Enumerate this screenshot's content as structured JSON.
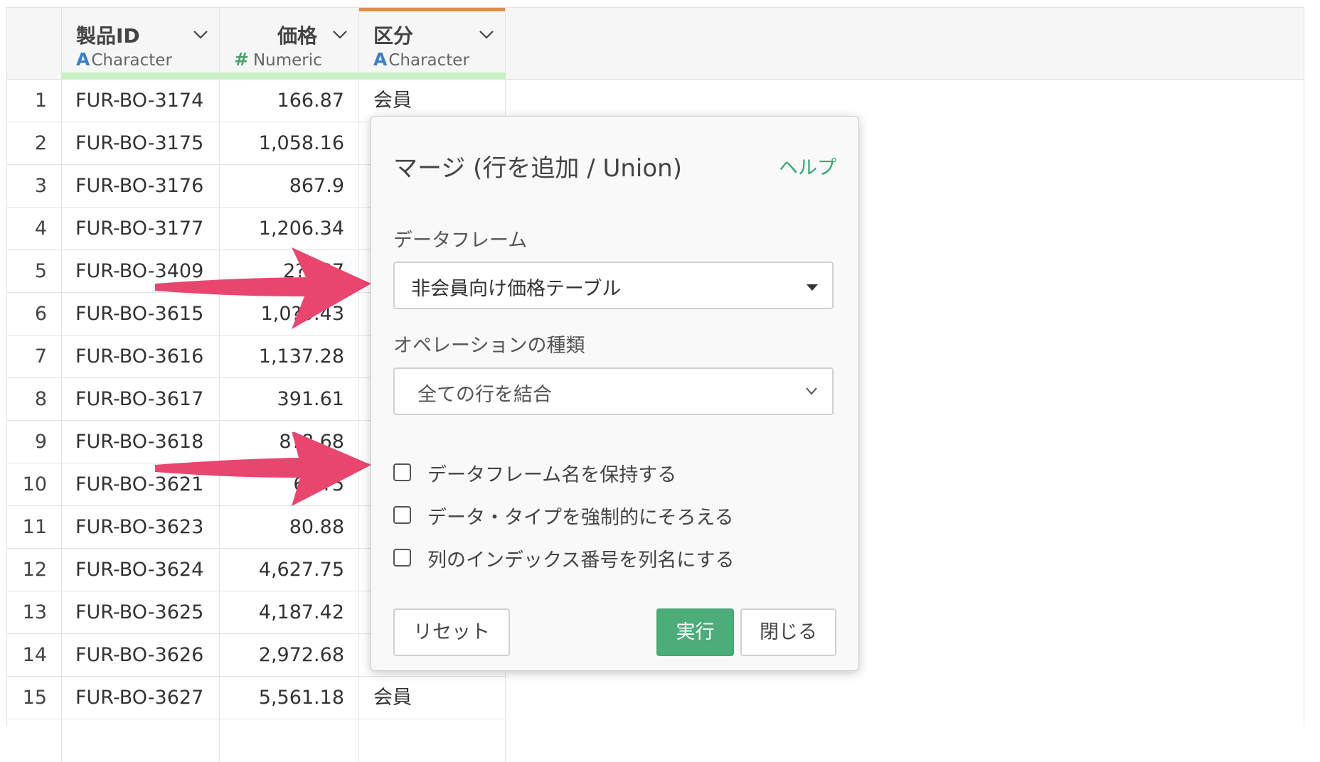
{
  "table": {
    "columns": [
      {
        "name": "製品ID",
        "type_icon": "A",
        "type_label": "Character"
      },
      {
        "name": "価格",
        "type_icon": "#",
        "type_label": "Numeric"
      },
      {
        "name": "区分",
        "type_icon": "A",
        "type_label": "Character"
      }
    ],
    "rows": [
      {
        "idx": "1",
        "id": "FUR-BO-3174",
        "price": "166.87",
        "kind": "会員"
      },
      {
        "idx": "2",
        "id": "FUR-BO-3175",
        "price": "1,058.16",
        "kind": ""
      },
      {
        "idx": "3",
        "id": "FUR-BO-3176",
        "price": "867.9",
        "kind": ""
      },
      {
        "idx": "4",
        "id": "FUR-BO-3177",
        "price": "1,206.34",
        "kind": ""
      },
      {
        "idx": "5",
        "id": "FUR-BO-3409",
        "price": "2??.?7",
        "kind": ""
      },
      {
        "idx": "6",
        "id": "FUR-BO-3615",
        "price": "1,0?5.43",
        "kind": ""
      },
      {
        "idx": "7",
        "id": "FUR-BO-3616",
        "price": "1,137.28",
        "kind": ""
      },
      {
        "idx": "8",
        "id": "FUR-BO-3617",
        "price": "391.61",
        "kind": ""
      },
      {
        "idx": "9",
        "id": "FUR-BO-3618",
        "price": "8?8.68",
        "kind": ""
      },
      {
        "idx": "10",
        "id": "FUR-BO-3621",
        "price": "6?.?5",
        "kind": ""
      },
      {
        "idx": "11",
        "id": "FUR-BO-3623",
        "price": "80.88",
        "kind": ""
      },
      {
        "idx": "12",
        "id": "FUR-BO-3624",
        "price": "4,627.75",
        "kind": ""
      },
      {
        "idx": "13",
        "id": "FUR-BO-3625",
        "price": "4,187.42",
        "kind": ""
      },
      {
        "idx": "14",
        "id": "FUR-BO-3626",
        "price": "2,972.68",
        "kind": ""
      },
      {
        "idx": "15",
        "id": "FUR-BO-3627",
        "price": "5,561.18",
        "kind": "会員"
      }
    ]
  },
  "dialog": {
    "title": "マージ (行を追加 / Union)",
    "help": "ヘルプ",
    "dataframe_label": "データフレーム",
    "dataframe_value": "非会員向け価格テーブル",
    "operation_label": "オペレーションの種類",
    "operation_value": "全ての行を結合",
    "checkboxes": [
      {
        "label": "データフレーム名を保持する",
        "checked": false
      },
      {
        "label": "データ・タイプを強制的にそろえる",
        "checked": false
      },
      {
        "label": "列のインデックス番号を列名にする",
        "checked": false
      }
    ],
    "reset": "リセット",
    "run": "実行",
    "close": "閉じる"
  },
  "colors": {
    "accent_green": "#4cad7b",
    "arrow_pink": "#e8466f",
    "type_char_blue": "#3b7fc4",
    "type_num_green": "#4aa26b",
    "active_column_top": "#e28f48",
    "quality_bar": "#c9efc5"
  }
}
